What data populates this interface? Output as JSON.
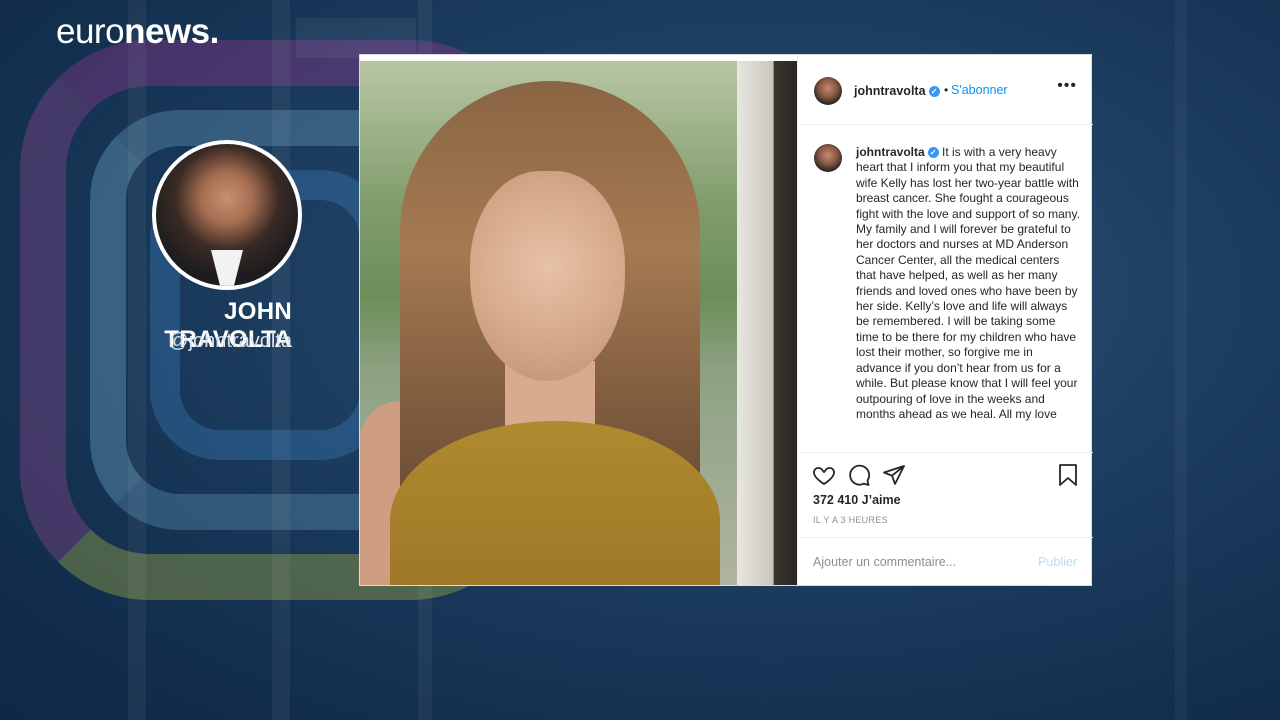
{
  "brand": {
    "logo_light": "euro",
    "logo_bold": "news",
    "logo_dot": "."
  },
  "profile": {
    "name": "JOHN TRAVOLTA",
    "handle": "@johntravolta"
  },
  "post": {
    "username": "johntravolta",
    "separator": "•",
    "follow_label": "S'abonner",
    "more_label": "•••",
    "caption": "It is with a very heavy heart that I inform you that my beautiful wife Kelly has lost her two-year battle with breast cancer. She fought a courageous fight with the love and support of so many.  My family and I will forever be grateful to her doctors and nurses at MD Anderson Cancer Center, all the medical centers that have helped, as well as her many friends and loved ones who have been by her side. Kelly’s love and life will always be remembered. I will be taking some time to be there for my children who have lost their mother, so forgive me in advance if you don’t hear from us for a while.  But please know that I will feel your outpouring of love in the weeks and months ahead as we heal. All my love",
    "likes": "372 410 J’aime",
    "time": "IL Y A 3 HEURES",
    "comment_placeholder": "Ajouter un commentaire...",
    "publish_label": "Publier"
  },
  "icons": [
    "heart-icon",
    "comment-icon",
    "share-icon",
    "bookmark-icon",
    "verified-icon"
  ],
  "colors": {
    "link": "#0095f6",
    "verified": "#3897f0",
    "publish_disabled": "#b2dffc"
  }
}
